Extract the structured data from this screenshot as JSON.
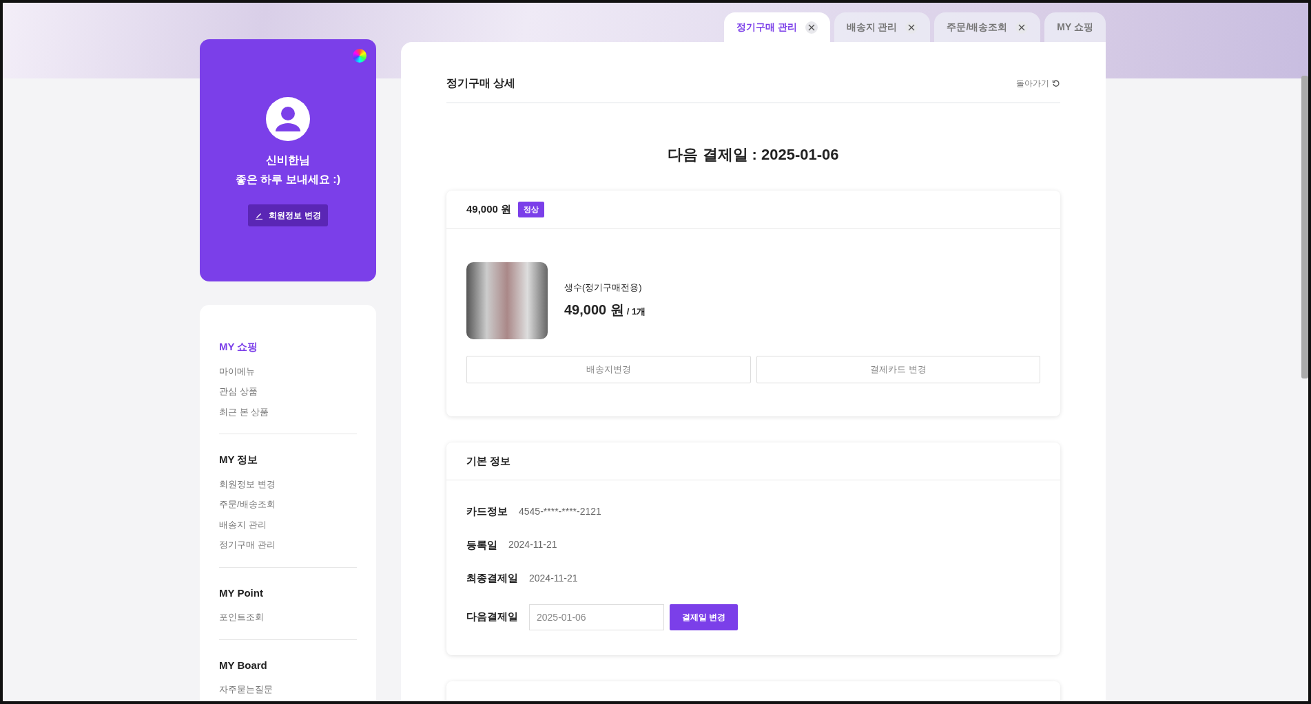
{
  "tabs": [
    {
      "label": "정기구매 관리",
      "selected": true,
      "closable": true
    },
    {
      "label": "배송지 관리",
      "selected": false,
      "closable": true
    },
    {
      "label": "주문/배송조회",
      "selected": false,
      "closable": true
    },
    {
      "label": "MY 쇼핑",
      "selected": false,
      "closable": false
    }
  ],
  "profile": {
    "name": "신비한님",
    "greeting": "좋은 하루 보내세요 :)",
    "edit_button": "회원정보 변경"
  },
  "sidebar": {
    "sections": [
      {
        "title": "MY 쇼핑",
        "selected": true,
        "items": [
          "마이메뉴",
          "관심 상품",
          "최근 본 상품"
        ]
      },
      {
        "title": "MY 정보",
        "selected": false,
        "items": [
          "회원정보 변경",
          "주문/배송조회",
          "배송지 관리",
          "정기구매 관리"
        ]
      },
      {
        "title": "MY Point",
        "selected": false,
        "items": [
          "포인트조회"
        ]
      },
      {
        "title": "MY Board",
        "selected": false,
        "items": [
          "자주묻는질문"
        ]
      }
    ]
  },
  "page": {
    "title": "정기구매 상세",
    "back_link": "돌아가기",
    "next_payment_heading": "다음 결제일 : 2025-01-06"
  },
  "order": {
    "total": "49,000 원",
    "status": "정상",
    "product": {
      "name": "생수(정기구매전용)",
      "price": "49,000 원",
      "quantity": "/ 1개"
    },
    "buttons": [
      "배송지변경",
      "결제카드 변경"
    ]
  },
  "basic_info": {
    "title": "기본 정보",
    "rows": [
      {
        "label": "카드정보",
        "value": "4545-****-****-2121"
      },
      {
        "label": "등록일",
        "value": "2024-11-21"
      },
      {
        "label": "최종결제일",
        "value": "2024-11-21"
      }
    ],
    "next_payment": {
      "label": "다음결제일",
      "value": "2025-01-06",
      "button": "결제일 변경"
    }
  }
}
